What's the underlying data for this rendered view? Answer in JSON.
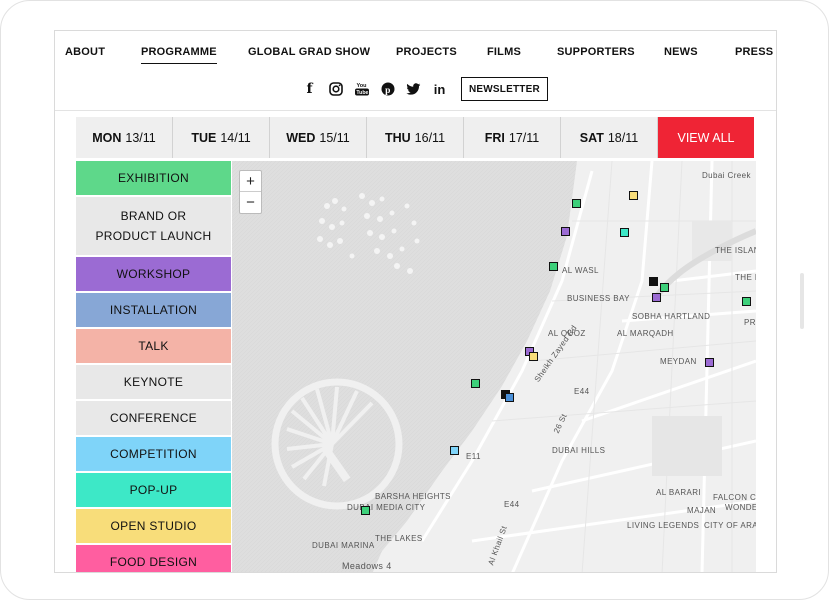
{
  "nav": {
    "links": [
      "ABOUT",
      "PROGRAMME",
      "GLOBAL GRAD SHOW",
      "PROJECTS",
      "FILMS",
      "SUPPORTERS",
      "NEWS",
      "PRESS"
    ],
    "active": "PROGRAMME",
    "newsletter": "NEWSLETTER",
    "social": [
      {
        "icon": "facebook-icon",
        "glyph": "f"
      },
      {
        "icon": "instagram-icon",
        "glyph": "◎"
      },
      {
        "icon": "youtube-icon",
        "glyph": "You Tube"
      },
      {
        "icon": "pinterest-icon",
        "glyph": "℗"
      },
      {
        "icon": "twitter-icon",
        "glyph": "🐦"
      },
      {
        "icon": "linkedin-icon",
        "glyph": "in"
      }
    ]
  },
  "days": [
    {
      "day": "MON",
      "date": "13/11"
    },
    {
      "day": "TUE",
      "date": "14/11"
    },
    {
      "day": "WED",
      "date": "15/11"
    },
    {
      "day": "THU",
      "date": "16/11"
    },
    {
      "day": "FRI",
      "date": "17/11"
    },
    {
      "day": "SAT",
      "date": "18/11"
    }
  ],
  "view_all": "VIEW ALL",
  "categories": [
    {
      "label": "EXHIBITION",
      "color": "#5ed88a"
    },
    {
      "label": "BRAND OR PRODUCT LAUNCH",
      "color": "#e8e8e8"
    },
    {
      "label": "WORKSHOP",
      "color": "#9b6bd3"
    },
    {
      "label": "INSTALLATION",
      "color": "#87a7d6"
    },
    {
      "label": "TALK",
      "color": "#f4b3a7"
    },
    {
      "label": "KEYNOTE",
      "color": "#e8e8e8"
    },
    {
      "label": "CONFERENCE",
      "color": "#e8e8e8"
    },
    {
      "label": "COMPETITION",
      "color": "#7fd4f9"
    },
    {
      "label": "POP-UP",
      "color": "#3de8c7"
    },
    {
      "label": "OPEN STUDIO",
      "color": "#f8dd7a"
    },
    {
      "label": "FOOD DESIGN",
      "color": "#ff5ea0"
    }
  ],
  "map": {
    "zoom_in": "+",
    "zoom_out": "−",
    "labels": [
      "Dubai Creek",
      "THE ISLAND",
      "THE R",
      "AL WASL",
      "BUSINESS BAY",
      "SOBHA HARTLAND",
      "PRE",
      "AL QUOZ",
      "AL MARQADH",
      "Sheikh Zayed Rd",
      "MEYDAN",
      "E44",
      "E11",
      "26 St",
      "DUBAI HILLS",
      "BARSHA HEIGHTS",
      "DUBAI MEDIA CITY",
      "THE LAKES",
      "DUBAI MARINA",
      "E44",
      "Al Khail St",
      "AL BARARI",
      "FALCON CITY",
      "WONDERS",
      "MAJAN",
      "LIVING LEGENDS",
      "CITY OF ARABIA",
      "Meadows 4"
    ],
    "markers": [
      {
        "color": "#f8dd7a"
      },
      {
        "color": "#3dd07a"
      },
      {
        "color": "#9b6bd3"
      },
      {
        "color": "#3de8c7"
      },
      {
        "color": "#3dd07a"
      },
      {
        "color": "#111111"
      },
      {
        "color": "#9b6bd3"
      },
      {
        "color": "#3dd07a"
      },
      {
        "color": "#3dd07a"
      },
      {
        "color": "#9b6bd3"
      },
      {
        "color": "#f8dd7a"
      },
      {
        "color": "#9b6bd3"
      },
      {
        "color": "#3dd07a"
      },
      {
        "color": "#111111"
      },
      {
        "color": "#4a90d9"
      },
      {
        "color": "#7fd4f9"
      },
      {
        "color": "#3dd07a"
      }
    ]
  }
}
